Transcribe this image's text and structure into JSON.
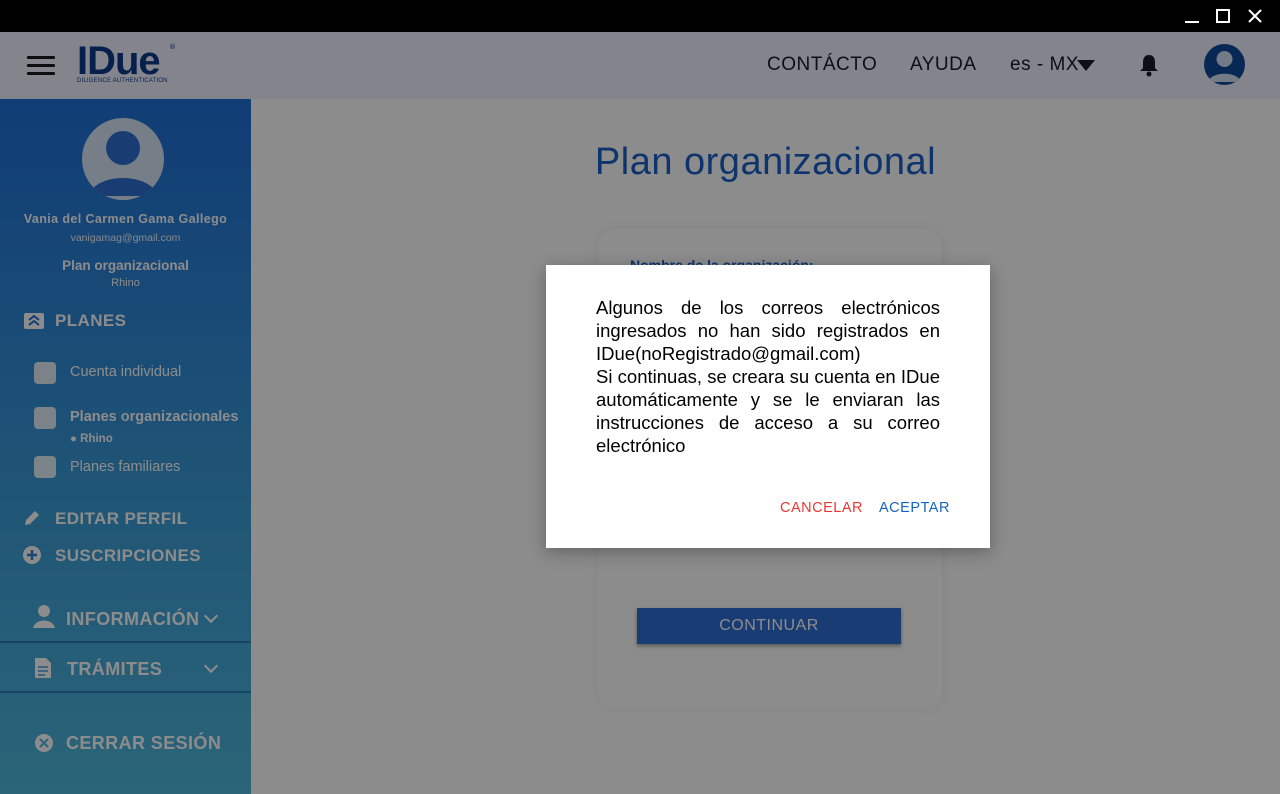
{
  "window": {
    "minimize_icon": "minimize-icon",
    "maximize_icon": "maximize-icon",
    "close_icon": "close-icon"
  },
  "header": {
    "logo_text": "IDue",
    "logo_subtitle": "DILIGENCE AUTHENTICATION",
    "nav": {
      "contacto": "CONTÁCTO",
      "ayuda": "AYUDA",
      "language": "es - MX"
    }
  },
  "sidebar": {
    "user_name": "Vania del Carmen Gama Gallego",
    "user_email": "vanigamag@gmail.com",
    "plan_title": "Plan organizacional",
    "plan_org": "Rhino",
    "planes_header": "PLANES",
    "items": {
      "individual": "Cuenta individual",
      "organizacionales": "Planes organizacionales",
      "organizacionales_sub": "● Rhino",
      "familiares": "Planes familiares"
    },
    "editar_perfil": "EDITAR PERFIL",
    "suscripciones": "SUSCRIPCIONES",
    "informacion": "INFORMACIÓN",
    "tramites": "TRÁMITES",
    "cerrar_sesion": "CERRAR SESIÓN"
  },
  "main": {
    "title": "Plan organizacional",
    "org_name_label": "Nombre de la organización:",
    "continue_label": "CONTINUAR"
  },
  "dialog": {
    "line1": "Algunos de los correos electrónicos ingresados no han sido registrados en IDue(noRegistrado@gmail.com)",
    "line2": "Si continuas, se creara su cuenta en IDue automáticamente y se le enviaran las instrucciones de acceso a su correo electrónico",
    "cancel_label": "CANCELAR",
    "accept_label": "ACEPTAR"
  },
  "colors": {
    "brand_blue": "#1a5fc7",
    "cancel_red": "#e53935",
    "accept_blue": "#1565c0"
  }
}
